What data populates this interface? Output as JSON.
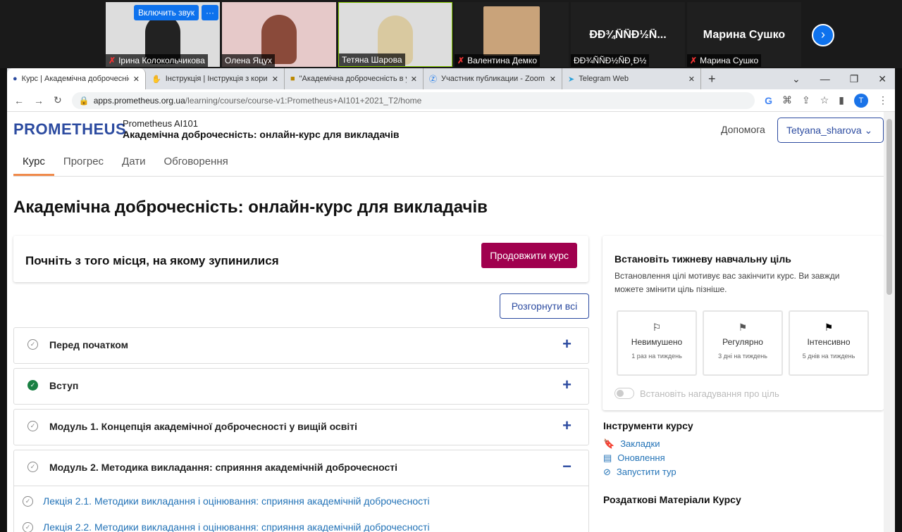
{
  "zoom": {
    "unmute_label": "Включить звук",
    "more_label": "···",
    "participants": [
      {
        "name": "Ірина Колокольчикова",
        "muted": true,
        "video": true
      },
      {
        "name": "Олена Яцух",
        "muted": false,
        "video": true
      },
      {
        "name": "Тетяна Шарова",
        "muted": false,
        "video": true
      },
      {
        "name": "Валентина Демко",
        "muted": true,
        "video": true
      },
      {
        "name": "ÐÐ¾ÑÑÐ½ÑÐ¸Ð½",
        "display": "ÐÐ¾ÑÑÐ½Ñ...",
        "muted": false,
        "video": false
      },
      {
        "name": "Марина Сушко",
        "display": "Марина Сушко",
        "muted": true,
        "video": false
      }
    ]
  },
  "browser": {
    "tabs": [
      {
        "title": "Курс | Академічна доброчесніс",
        "active": true
      },
      {
        "title": "Інструкція | Інструкція з корист"
      },
      {
        "title": "\"Академічна доброчесність в у"
      },
      {
        "title": "Участник публикации - Zoom"
      },
      {
        "title": "Telegram Web"
      }
    ],
    "url_domain": "apps.prometheus.org.ua",
    "url_path": "/learning/course/course-v1:Prometheus+AI101+2021_T2/home",
    "profile": "T"
  },
  "header": {
    "logo": "PROMETHEUS",
    "org": "Prometheus AI101",
    "course_title": "Академічна доброчесність: онлайн-курс для викладачів",
    "help": "Допомога",
    "user": "Tetyana_sharova"
  },
  "nav": [
    "Курс",
    "Прогрес",
    "Дати",
    "Обговорення"
  ],
  "main": {
    "title": "Академічна доброчесність: онлайн-курс для викладачів",
    "resume_text": "Почніть з того місця, на якому зупинилися",
    "resume_button": "Продовжити курс",
    "expand_all": "Розгорнути всі",
    "sections": [
      {
        "label": "Перед початком",
        "done": false,
        "toggle": "+"
      },
      {
        "label": "Вступ",
        "done": true,
        "toggle": "+"
      },
      {
        "label": "Модуль 1. Концепція академічної доброчесності у вищій освіті",
        "done": false,
        "toggle": "+"
      },
      {
        "label": "Модуль 2. Методика викладання: сприяння академічній доброчесності",
        "done": false,
        "toggle": "−"
      }
    ],
    "lectures": [
      "Лекція 2.1. Методики викладання і оцінювання: сприяння академічній доброчесності",
      "Лекція 2.2. Методики викладання і оцінювання: сприяння академічній доброчесності"
    ]
  },
  "goal": {
    "title": "Встановіть тижневу навчальну ціль",
    "desc": "Встановлення цілі мотивує вас закінчити курс. Ви завжди можете змінити ціль пізніше.",
    "options": [
      {
        "name": "Невимушено",
        "desc": "1 раз на тиждень"
      },
      {
        "name": "Регулярно",
        "desc": "3 дні на тиждень"
      },
      {
        "name": "Інтенсивно",
        "desc": "5 днів на тиждень"
      }
    ],
    "reminder": "Встановіть нагадування про ціль"
  },
  "tools": {
    "title": "Інструменти курсу",
    "items": [
      "Закладки",
      "Оновлення",
      "Запустити тур"
    ]
  },
  "handouts": "Роздаткові Матеріали Курсу"
}
